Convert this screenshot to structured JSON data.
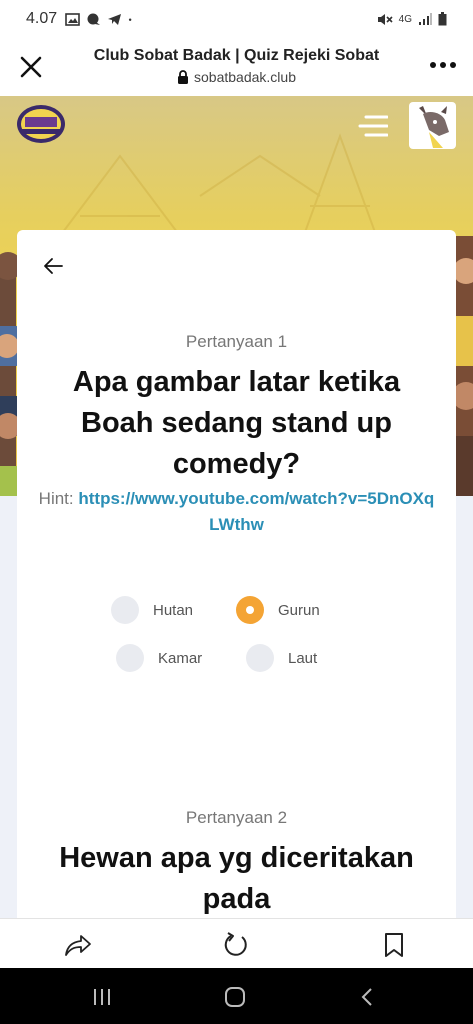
{
  "status": {
    "time": "4.07",
    "network": "4G"
  },
  "browser": {
    "title": "Club Sobat Badak | Quiz Rejeki Sobat",
    "url": "sobatbadak.club",
    "close_icon": "close-icon",
    "more_icon": "more-icon"
  },
  "hero": {
    "logo_text": "CLUB SOBAT BADAK"
  },
  "questions": [
    {
      "number": "Pertanyaan 1",
      "text": "Apa gambar latar ketika Boah sedang stand up comedy?",
      "hint_label": "Hint:",
      "hint_link": "https://www.youtube.com/watch?v=5DnOXqLWthw",
      "options": [
        {
          "label": "Hutan",
          "selected": false
        },
        {
          "label": "Gurun",
          "selected": true
        },
        {
          "label": "Kamar",
          "selected": false
        },
        {
          "label": "Laut",
          "selected": false
        }
      ]
    },
    {
      "number": "Pertanyaan 2",
      "text": "Hewan apa yg diceritakan pada"
    }
  ],
  "colors": {
    "accent": "#f4a434",
    "link": "#2b8fb6",
    "hero": "#f1d44f"
  }
}
